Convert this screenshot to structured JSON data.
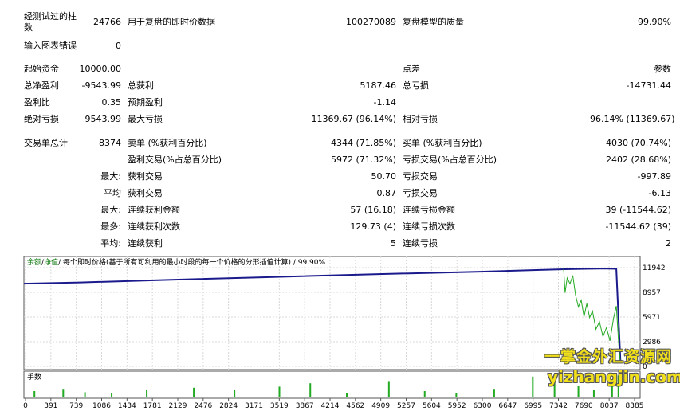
{
  "report": {
    "bars_label": "经测试过的柱",
    "bars_label2": "数",
    "bars_value": "24766",
    "ticks_label": "用于复盘的即时价数据",
    "ticks_value": "100270089",
    "quality_label": "复盘模型的质量",
    "quality_value": "99.90%",
    "errors_label": "输入图表错误",
    "errors_value": "0",
    "deposit_label": "起始资金",
    "deposit_value": "10000.00",
    "spread_label": "点差",
    "spread_value": "参数",
    "net_label": "总净盈利",
    "net_value": "-9543.99",
    "gross_profit_label": "总获利",
    "gross_profit_value": "5187.46",
    "gross_loss_label": "总亏损",
    "gross_loss_value": "-14731.44",
    "pf_label": "盈利比",
    "pf_value": "0.35",
    "payoff_label": "预期盈利",
    "payoff_value": "-1.14",
    "abs_dd_label": "绝对亏损",
    "abs_dd_value": "9543.99",
    "max_dd_label": "最大亏损",
    "max_dd_value": "11369.67 (96.14%)",
    "rel_dd_label": "相对亏损",
    "rel_dd_value": "96.14% (11369.67)",
    "trades_label": "交易单总计",
    "trades_value": "8374",
    "short_label": "卖单 (%获利百分比)",
    "short_value": "4344 (71.85%)",
    "long_label": "买单 (%获利百分比)",
    "long_value": "4030 (70.74%)",
    "profit_trades_label": "盈利交易(%占总百分比)",
    "profit_trades_value": "5972 (71.32%)",
    "loss_trades_label": "亏损交易(%占总百分比)",
    "loss_trades_value": "2402 (28.68%)",
    "largest": "最大:",
    "largest_profit_label": "获利交易",
    "largest_profit_value": "50.70",
    "largest_loss_label": "亏损交易",
    "largest_loss_value": "-997.89",
    "average": "平均",
    "avg_profit_label": "获利交易",
    "avg_profit_value": "0.87",
    "avg_loss_label": "亏损交易",
    "avg_loss_value": "-6.13",
    "max_label": "最大:",
    "max_consec_wins_label": "连续获利金额",
    "max_consec_wins_value": "57 (16.18)",
    "max_consec_losses_label": "连续亏损金额",
    "max_consec_losses_value": "39 (-11544.62)",
    "most_label": "最多:",
    "max_consec_profit_label": "连续获利次数",
    "max_consec_profit_value": "129.73 (4)",
    "max_consec_loss_label": "连续亏损次数",
    "max_consec_loss_value": "-11544.62 (39)",
    "avg2_label": "平均:",
    "avg_consec_wins_label": "连续获利",
    "avg_consec_wins_value": "5",
    "avg_consec_losses_label": "连续亏损",
    "avg_consec_losses_value": "2"
  },
  "chart_caption": {
    "balance": "余额",
    "sep1": "/",
    "equity": "净值",
    "rest": "/ 每个即时价格(基于所有可利用的最小时段的每一个价格的分形插值计算) / 99.90%"
  },
  "volume_caption": "手数",
  "watermark": {
    "line1": "一掌金外汇资源网",
    "line2": "yizhangjin.com"
  },
  "colors": {
    "balance": "#1a1a8c",
    "equity": "#22aa22",
    "volume": "#22aa22"
  },
  "chart_data": {
    "type": "line",
    "y_ticks": [
      "11942",
      "8957",
      "5971",
      "2986",
      "0"
    ],
    "x_ticks": [
      "0",
      "391",
      "739",
      "1086",
      "1434",
      "1781",
      "2129",
      "2476",
      "2824",
      "3171",
      "3519",
      "3867",
      "4214",
      "4562",
      "4909",
      "5257",
      "5604",
      "5952",
      "6300",
      "6647",
      "6995",
      "7342",
      "7690",
      "8037",
      "8385"
    ],
    "ylim": [
      0,
      11942
    ],
    "xlim": [
      0,
      8700
    ],
    "series": [
      {
        "name": "余额",
        "x": [
          0,
          800,
          2000,
          3500,
          5000,
          6500,
          7300,
          7700,
          8000,
          8300,
          8440,
          8500
        ],
        "y": [
          10000,
          10150,
          10450,
          10800,
          11150,
          11450,
          11650,
          11750,
          11800,
          11830,
          11800,
          450
        ]
      },
      {
        "name": "净值",
        "x": [
          7690,
          7710,
          7740,
          7780,
          7820,
          7860,
          7900,
          7940,
          7980,
          8020,
          8060,
          8100,
          8150,
          8200,
          8250,
          8300,
          8350,
          8400,
          8440,
          8480,
          8500
        ],
        "y": [
          11800,
          8900,
          10700,
          10000,
          11000,
          8600,
          7200,
          8000,
          6000,
          7600,
          5900,
          6700,
          4500,
          5400,
          3600,
          4700,
          3100,
          5800,
          7300,
          2000,
          400
        ]
      }
    ],
    "volume": [
      {
        "x": 150,
        "v": 0.25
      },
      {
        "x": 560,
        "v": 0.35
      },
      {
        "x": 870,
        "v": 0.2
      },
      {
        "x": 1250,
        "v": 0.15
      },
      {
        "x": 1750,
        "v": 0.3
      },
      {
        "x": 2420,
        "v": 0.4
      },
      {
        "x": 3000,
        "v": 0.3
      },
      {
        "x": 3640,
        "v": 0.45
      },
      {
        "x": 4080,
        "v": 0.6
      },
      {
        "x": 4600,
        "v": 0.15
      },
      {
        "x": 5200,
        "v": 0.7
      },
      {
        "x": 5710,
        "v": 0.25
      },
      {
        "x": 6160,
        "v": 0.15
      },
      {
        "x": 6700,
        "v": 0.35
      },
      {
        "x": 7250,
        "v": 0.9
      },
      {
        "x": 7560,
        "v": 0.85
      },
      {
        "x": 7900,
        "v": 0.5
      },
      {
        "x": 8120,
        "v": 0.3
      },
      {
        "x": 8380,
        "v": 0.6
      },
      {
        "x": 8470,
        "v": 0.95
      }
    ]
  }
}
